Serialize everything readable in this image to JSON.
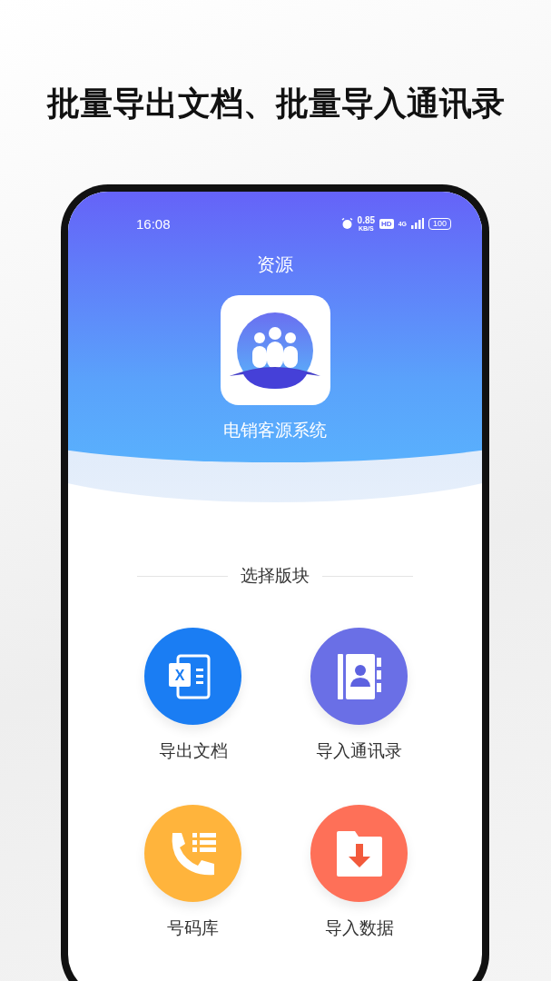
{
  "headline": "批量导出文档、批量导入通讯录",
  "status_bar": {
    "time": "16:08",
    "speed": "0.85",
    "speed_unit": "KB/S",
    "hd": "HD",
    "network": "4G",
    "battery": "100"
  },
  "title": "资源",
  "app_name": "电销客源系统",
  "section_title": "选择版块",
  "tiles": [
    {
      "kind": "excel",
      "label": "导出文档",
      "color": "#1a7df3",
      "icon_letter": "X"
    },
    {
      "kind": "contacts",
      "label": "导入通讯录",
      "color": "#6a6fe6"
    },
    {
      "kind": "phone-list",
      "label": "号码库",
      "color": "#ffb43c"
    },
    {
      "kind": "folder-download",
      "label": "导入数据",
      "color": "#fe7058"
    }
  ]
}
